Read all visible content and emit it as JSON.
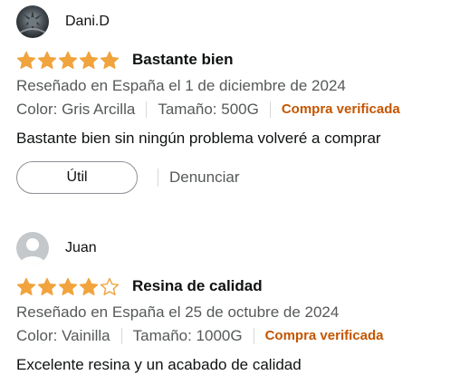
{
  "reviews": [
    {
      "profile_name": "Dani.D",
      "avatar": "photo-avatar",
      "rating": 5,
      "max_rating": 5,
      "title": "Bastante bien",
      "date": "Reseñado en España el 1 de diciembre de 2024",
      "color": "Color: Gris Arcilla",
      "size": "Tamaño: 500G",
      "verified": "Compra verificada",
      "body": "Bastante bien sin ningún problema volveré a comprar",
      "helpful_label": "Útil",
      "report_label": "Denunciar"
    },
    {
      "profile_name": "Juan",
      "avatar": "default-user-avatar",
      "rating": 4,
      "max_rating": 5,
      "title": "Resina de calidad",
      "date": "Reseñado en España el 25 de octubre de 2024",
      "color": "Color: Vainilla",
      "size": "Tamaño: 1000G",
      "verified": "Compra verificada",
      "body": "Excelente resina y un acabado de calidad"
    }
  ],
  "colors": {
    "star": "#f1a33d",
    "verified": "#c45500",
    "muted": "#565959",
    "text": "#0f1111"
  }
}
